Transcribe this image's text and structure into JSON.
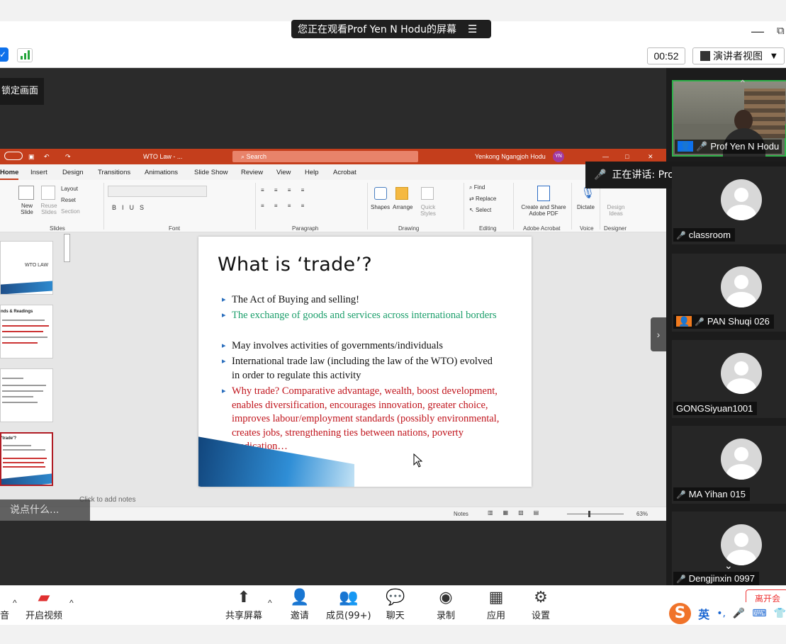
{
  "banner": {
    "text": "您正在观看Prof Yen N Hodu的屏幕",
    "menu": "☰"
  },
  "toolbar": {
    "timer": "00:52",
    "view_label": "演讲者视图"
  },
  "lock_tip": "锁定画面",
  "ppt": {
    "title": "WTO Law - ...",
    "search": "Search",
    "user": "Yenkong Ngangjoh Hodu",
    "user_initials": "YN",
    "tabs": [
      "Home",
      "Insert",
      "Design",
      "Transitions",
      "Animations",
      "Slide Show",
      "Review",
      "View",
      "Help",
      "Acrobat"
    ],
    "ribbon": {
      "new_slide": "New Slide",
      "reuse_slides": "Reuse Slides",
      "layout": "Layout",
      "reset": "Reset",
      "section": "Section",
      "shapes": "Shapes",
      "arrange": "Arrange",
      "quick_styles": "Quick Styles",
      "find": "Find",
      "replace": "Replace",
      "select": "Select",
      "create_share": "Create and Share Adobe PDF",
      "dictate": "Dictate",
      "design_ideas": "Design Ideas",
      "groups": [
        "Slides",
        "Font",
        "Paragraph",
        "Drawing",
        "Editing",
        "Adobe Acrobat",
        "Voice",
        "Designer"
      ]
    },
    "thumb1_title": "WTO LAW",
    "thumb2_title": "nds & Readings",
    "thumb4_title": "'trade'?",
    "slide": {
      "title": "What is ‘trade’?",
      "bullets": [
        {
          "text": "The Act of Buying and selling!",
          "color": "#111111"
        },
        {
          "text": "The exchange of goods and services across international borders",
          "color": "#1a9e6a"
        },
        {
          "text": "May involves activities of governments/individuals",
          "color": "#111111"
        },
        {
          "text": "International trade law (including the law of the WTO) evolved in order to regulate this activity",
          "color": "#111111"
        },
        {
          "text": "Why trade? Comparative advantage, wealth, boost development, enables diversification, encourages innovation, greater choice, improves labour/employment standards (possibly environmental, creates jobs, strengthening ties between nations, poverty eradication…",
          "color": "#c0141c"
        }
      ]
    },
    "notes_placeholder": "Click to add notes",
    "status": {
      "notes": "Notes",
      "zoom": "63%"
    }
  },
  "chat_prompt": "说点什么...",
  "gallery": {
    "active_speaker": "Prof Yen N Hodu",
    "speaking_label": "正在讲话: Prof Yen N Hodu;",
    "participants": [
      "classroom",
      "PAN Shuqi 026",
      "GONGSiyuan1001",
      "MA Yihan 015",
      "Dengjinxin 0997"
    ]
  },
  "bottom": {
    "audio": "音",
    "video": "开启视频",
    "share": "共享屏幕",
    "invite": "邀请",
    "members": "成员(99+)",
    "chat": "聊天",
    "record": "录制",
    "apps": "应用",
    "settings": "设置",
    "end": "离开会"
  },
  "ime": {
    "lang": "英"
  }
}
